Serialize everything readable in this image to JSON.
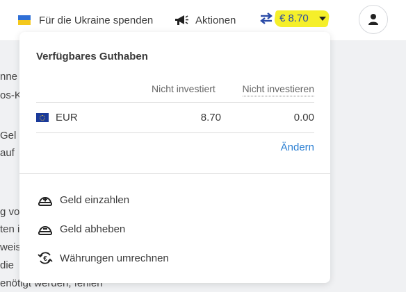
{
  "topbar": {
    "ukraine_label": "Für die Ukraine spenden",
    "actions_label": "Aktionen",
    "balance": "€ 8.70"
  },
  "background_text": [
    "nne",
    "os-K",
    "Gel",
    "auf",
    "g vo",
    "ten i",
    "weis",
    "die",
    "enötigt werden, fehlen"
  ],
  "dropdown": {
    "title": "Verfügbares Guthaben",
    "columns": [
      "Nicht investiert",
      "Nicht investieren"
    ],
    "row": {
      "currency": "EUR",
      "not_invested": "8.70",
      "not_to_invest": "0.00"
    },
    "change_label": "Ändern",
    "menu": [
      {
        "label": "Geld einzahlen",
        "icon": "deposit-icon"
      },
      {
        "label": "Geld abheben",
        "icon": "withdraw-icon"
      },
      {
        "label": "Währungen umrechnen",
        "icon": "currency-exchange-icon"
      }
    ]
  },
  "colors": {
    "accent_blue": "#2b4ba7",
    "link_blue": "#2b7fd2",
    "highlight_yellow": "#f5ef2a",
    "ukraine_blue": "#2f6fd6",
    "ukraine_yellow": "#f4c81c"
  }
}
